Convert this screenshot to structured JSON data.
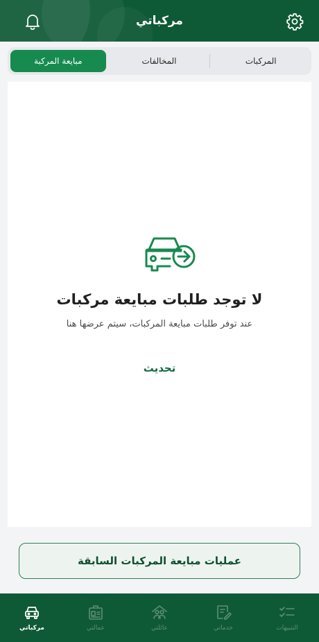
{
  "header": {
    "title": "مركباتي"
  },
  "tabs": [
    {
      "label": "المركبات",
      "active": false
    },
    {
      "label": "المخالفات",
      "active": false
    },
    {
      "label": "مبايعة المركبة",
      "active": true
    }
  ],
  "empty_state": {
    "title": "لا توجد طلبات مبايعة مركبات",
    "subtitle": "عند توفر طلبات مبايعة المركبات، سيتم عرضها هنا",
    "refresh_label": "تحديث"
  },
  "previous_button": {
    "label": "عمليات مبايعة المركبات السابقة"
  },
  "bottom_nav": [
    {
      "label": "التنبيهات",
      "icon": "checklist-icon",
      "active": false
    },
    {
      "label": "خدماتي",
      "icon": "edit-document-icon",
      "active": false
    },
    {
      "label": "عائلتي",
      "icon": "family-icon",
      "active": false
    },
    {
      "label": "عمالتي",
      "icon": "worker-id-icon",
      "active": false
    },
    {
      "label": "مركباتي",
      "icon": "car-icon",
      "active": true
    }
  ],
  "colors": {
    "primary": "#0f5a36",
    "accent": "#168a4f",
    "nav_inactive": "#5f8f74"
  }
}
